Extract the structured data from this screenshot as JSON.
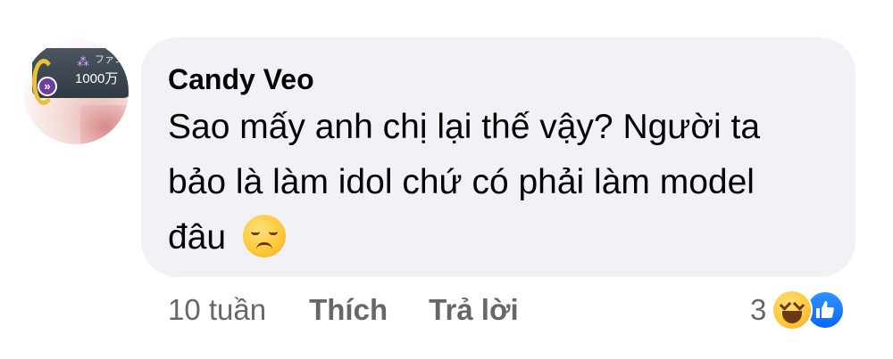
{
  "avatar": {
    "fan_label": "ファン",
    "fan_count": "1000万",
    "badge": "»"
  },
  "comment": {
    "author": "Candy Veo",
    "text": "Sao mấy anh chị lại thế vậy? Người ta bảo là làm idol chứ có phải làm model đâu",
    "emoji": "sad-face-emoji"
  },
  "footer": {
    "time": "10 tuần",
    "like_label": "Thích",
    "reply_label": "Trả lời"
  },
  "reactions": {
    "count": "3",
    "types": [
      "haha",
      "like"
    ],
    "like_color": "#0866ff",
    "haha_color": "#ffc93c"
  },
  "colors": {
    "bubble_bg": "#f0f2f5",
    "secondary_text": "#65676b",
    "primary_text": "#050505"
  }
}
